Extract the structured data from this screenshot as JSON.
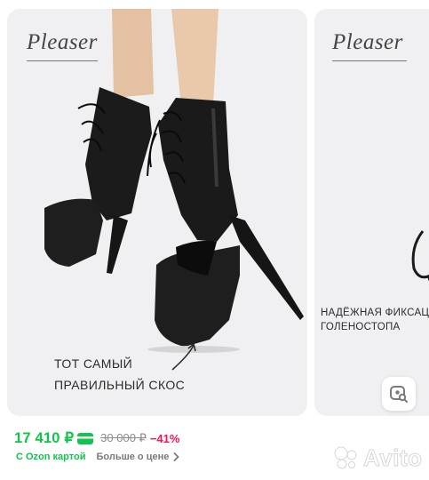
{
  "gallery": {
    "card1": {
      "brand_logo": "Pleaser",
      "caption_line1": "ТОТ САМЫЙ",
      "caption_line2": "ПРАВИЛЬНЫЙ СКОС"
    },
    "card2": {
      "brand_logo": "Pleaser",
      "caption_line1": "НАДЁЖНАЯ ФИКСАЦ",
      "caption_line2": "ГОЛЕНОСТОПА"
    },
    "search_icon": "image-search-icon"
  },
  "pricing": {
    "current_price": "17 410 ₽",
    "old_price": "30 000 ₽",
    "discount": "−41%",
    "card_icon": "green-card-icon",
    "ozon_card_label": "С Ozon картой",
    "more_label": "Больше о цене",
    "chevron_icon": "chevron-right-icon"
  },
  "watermark": {
    "text": "Avito"
  },
  "colors": {
    "price_green": "#10c44c",
    "discount_pink": "#f91155",
    "card_bg": "#f0f0f2"
  }
}
